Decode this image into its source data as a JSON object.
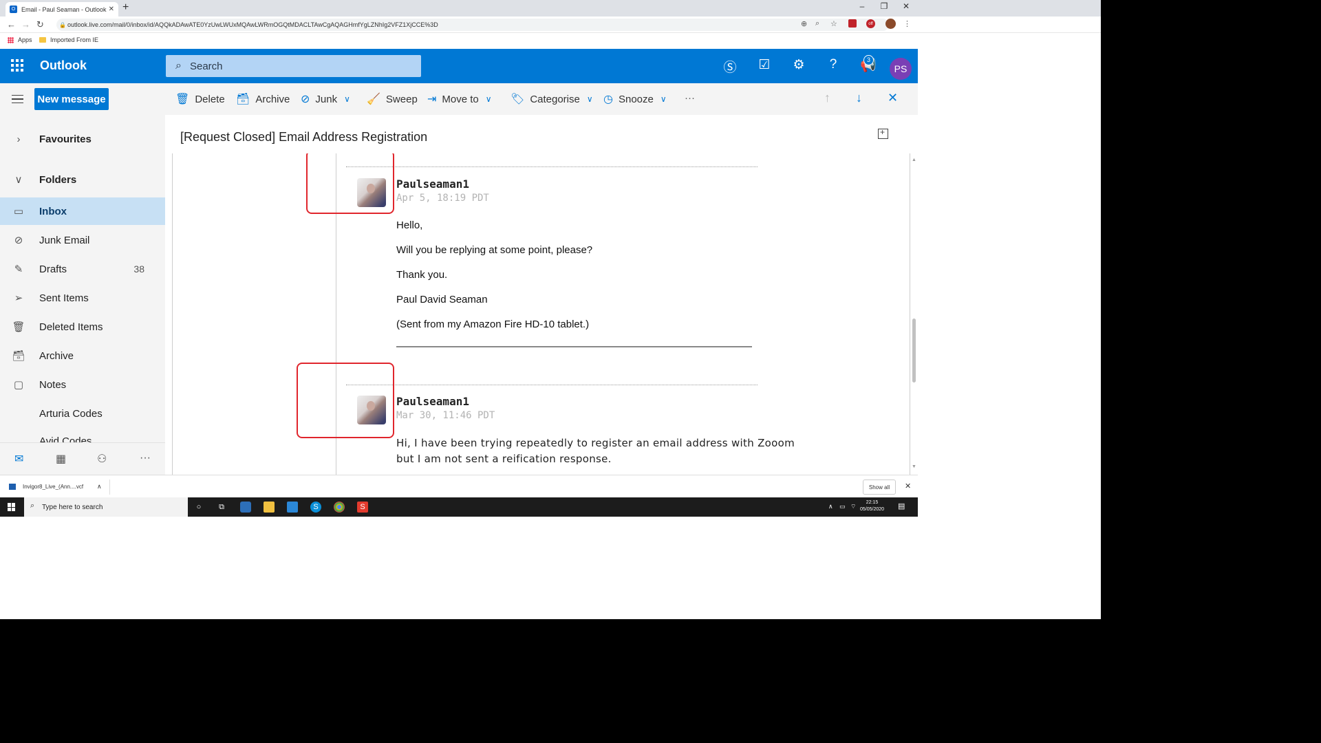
{
  "browser": {
    "tab_title": "Email - Paul Seaman - Outlook",
    "url": "outlook.live.com/mail/0/inbox/id/AQQkADAwATE0YzUwLWUxMQAwLWRmOGQtMDACLTAwCgAQAGHmfYgLZNhIg2VFZ1XjCCE%3D",
    "bookmarks": [
      "Apps",
      "Imported From IE"
    ],
    "ext_badge": "off"
  },
  "header": {
    "app_name": "Outlook",
    "search_placeholder": "Search",
    "notification_count": "3",
    "avatar_initials": "PS"
  },
  "toolbar": {
    "new_message": "New message",
    "delete": "Delete",
    "archive": "Archive",
    "junk": "Junk",
    "sweep": "Sweep",
    "move_to": "Move to",
    "categorise": "Categorise",
    "snooze": "Snooze",
    "more": "···"
  },
  "sidebar": {
    "favourites": "Favourites",
    "folders": "Folders",
    "items": [
      {
        "label": "Inbox",
        "icon": "inbox-icon",
        "count": ""
      },
      {
        "label": "Junk Email",
        "icon": "block-icon",
        "count": ""
      },
      {
        "label": "Drafts",
        "icon": "pencil-icon",
        "count": "38"
      },
      {
        "label": "Sent Items",
        "icon": "send-icon",
        "count": ""
      },
      {
        "label": "Deleted Items",
        "icon": "trash-icon",
        "count": ""
      },
      {
        "label": "Archive",
        "icon": "archive-icon",
        "count": ""
      },
      {
        "label": "Notes",
        "icon": "note-icon",
        "count": ""
      },
      {
        "label": "Arturia Codes",
        "icon": "",
        "count": ""
      },
      {
        "label": "Avid Codes",
        "icon": "",
        "count": ""
      }
    ]
  },
  "reading": {
    "subject": "[Request Closed] Email Address Registration",
    "messages": [
      {
        "sender": "Paulseaman1",
        "timestamp": "Apr 5, 18:19 PDT",
        "lines": [
          "Hello,",
          "Will you be replying at some point, please?",
          "Thank you.",
          "Paul David Seaman",
          "(Sent from my Amazon Fire HD-10 tablet.)"
        ]
      },
      {
        "sender": "Paulseaman1",
        "timestamp": "Mar 30, 11:46 PDT",
        "lines": [
          "Hi, I have been trying repeatedly to register an email address with Zooom",
          "but I am not sent a reification response."
        ]
      }
    ]
  },
  "downloads": {
    "file": "Invigor8_Live_(Ann....vcf",
    "show_all": "Show all"
  },
  "taskbar": {
    "search_placeholder": "Type here to search",
    "time": "22:15",
    "date": "05/05/2020"
  },
  "colors": {
    "outlook_blue": "#0078d4",
    "selected_folder": "#c7e0f4",
    "highlight_red": "#e0252c"
  }
}
